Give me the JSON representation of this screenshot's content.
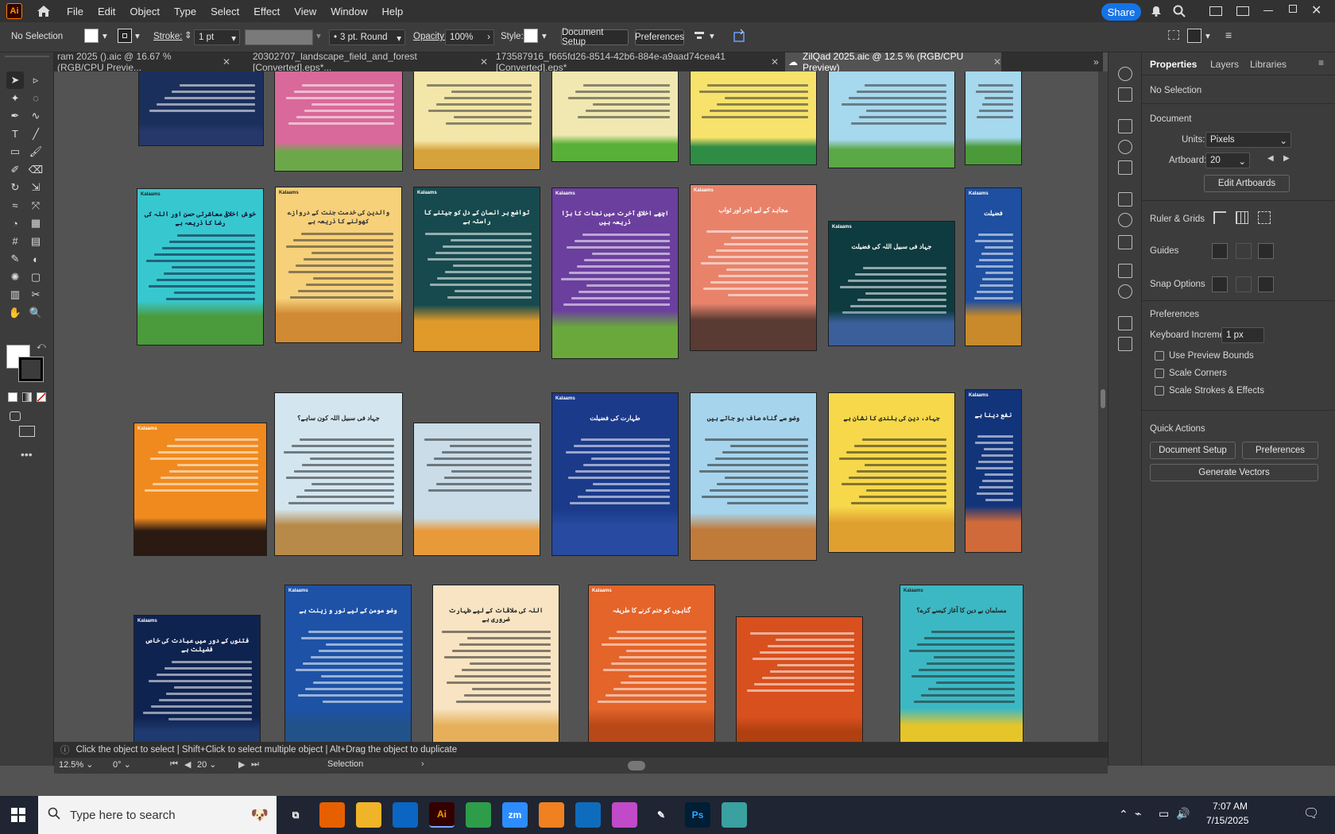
{
  "menubar": {
    "app_logo": "Ai",
    "items": [
      "File",
      "Edit",
      "Object",
      "Type",
      "Select",
      "Effect",
      "View",
      "Window",
      "Help"
    ],
    "share_label": "Share"
  },
  "control": {
    "selection_label": "No Selection",
    "stroke_label": "Stroke:",
    "stroke_value": "1 pt",
    "brush_value": "3 pt. Round",
    "opacity_label": "Opacity:",
    "opacity_value": "100%",
    "style_label": "Style:",
    "document_setup": "Document Setup",
    "preferences": "Preferences"
  },
  "tabs": [
    {
      "label": "ram 2025 ().aic @ 16.67 % (RGB/CPU Previe...",
      "active": false
    },
    {
      "label": "20302707_landscape_field_and_forest [Converted].eps*...",
      "active": false
    },
    {
      "label": "173587916_f665fd26-8514-42b6-884e-a9aad74cea41 [Converted].eps*",
      "active": false
    },
    {
      "label": "ZilQad 2025.aic @ 12.5 % (RGB/CPU Preview)",
      "active": true
    }
  ],
  "artboards": [
    {
      "brand": "",
      "title": "",
      "bg": "#1b2f5c",
      "scene": "#26386a",
      "fg": "#fff"
    },
    {
      "brand": "",
      "title": "",
      "bg": "#d9699a",
      "scene": "#6ca84a",
      "fg": "#fff"
    },
    {
      "brand": "",
      "title": "",
      "bg": "#f3e6a8",
      "scene": "#d6a23b",
      "fg": "#333"
    },
    {
      "brand": "",
      "title": "",
      "bg": "#f0e8b0",
      "scene": "#58b038",
      "fg": "#333"
    },
    {
      "brand": "",
      "title": "",
      "bg": "#f7e36b",
      "scene": "#2f8c44",
      "fg": "#333"
    },
    {
      "brand": "",
      "title": "",
      "bg": "#a6d8ee",
      "scene": "#5aa846",
      "fg": "#333"
    },
    {
      "brand": "",
      "title": "",
      "bg": "#a6d8ee",
      "scene": "#4a9a3a",
      "fg": "#333"
    },
    {
      "brand": "Kalaams",
      "title": "خوش اخلاقی معاشرتی حسن اور اللہ کی رضا کا ذریعہ ہے",
      "bg": "#37c8cf",
      "scene": "#4b9a3b",
      "fg": "#113"
    },
    {
      "brand": "Kalaams",
      "title": "والدین کی خدمت جنت کے دروازے کھولنے کا ذریعہ ہے",
      "bg": "#f7d07a",
      "scene": "#d08a34",
      "fg": "#333"
    },
    {
      "brand": "Kalaams",
      "title": "تواضع ہر انسان کے دل کو جیتنے کا راستہ ہے",
      "bg": "#174a4e",
      "scene": "#e09a2a",
      "fg": "#fff"
    },
    {
      "brand": "Kalaams",
      "title": "اچھے اخلاق آخرت میں نجات کا بڑا ذریعہ ہیں",
      "bg": "#6b3f9e",
      "scene": "#6aa83c",
      "fg": "#fff"
    },
    {
      "brand": "Kalaams",
      "title": "مجاہد کے لیے اجر اور ثواب",
      "bg": "#e8836a",
      "scene": "#5a3b33",
      "fg": "#fff"
    },
    {
      "brand": "Kalaams",
      "title": "جہاد فی سبیل اللہ کی فضیلت",
      "bg": "#0d3b40",
      "scene": "#3a5f9a",
      "fg": "#fff"
    },
    {
      "brand": "Kalaams",
      "title": "فضیلت",
      "bg": "#1e4fa0",
      "scene": "#c88a2a",
      "fg": "#fff"
    },
    {
      "brand": "Kalaams",
      "title": "",
      "bg": "#f08a1e",
      "scene": "#2a1a12",
      "fg": "#fff"
    },
    {
      "brand": "",
      "title": "جہاد فی سبیل اللہ کون ساہے؟",
      "bg": "#d3e6f0",
      "scene": "#b88a4a",
      "fg": "#222"
    },
    {
      "brand": "",
      "title": "",
      "bg": "#c9dce8",
      "scene": "#e89a3a",
      "fg": "#222"
    },
    {
      "brand": "Kalaams",
      "title": "طہارت کی فضیلت",
      "bg": "#1b3a8a",
      "scene": "#284aa0",
      "fg": "#fff"
    },
    {
      "brand": "",
      "title": "وضو سے گناہ صاف ہو جاتے ہیں",
      "bg": "#a6d4ec",
      "scene": "#c07a3a",
      "fg": "#222"
    },
    {
      "brand": "",
      "title": "جہاد، دین کی بلندی کا نشان ہے",
      "bg": "#f6d84a",
      "scene": "#e0a030",
      "fg": "#222"
    },
    {
      "brand": "Kalaams",
      "title": "نفع دینا ہے",
      "bg": "#12347a",
      "scene": "#d06a3a",
      "fg": "#fff"
    },
    {
      "brand": "Kalaams",
      "title": "فتنوں کے دور میں عبادت کی خاص فضیلت ہے",
      "bg": "#0f2350",
      "scene": "#1e3a70",
      "fg": "#fff"
    },
    {
      "brand": "Kalaams",
      "title": "وضو مومن کے لیے نور و زینت ہے",
      "bg": "#1d52a6",
      "scene": "#22528a",
      "fg": "#fff"
    },
    {
      "brand": "",
      "title": "اللہ کی ملاقات کے لیے طہارت ضروری ہے",
      "bg": "#f8e4c2",
      "scene": "#e6b05a",
      "fg": "#222"
    },
    {
      "brand": "Kalaams",
      "title": "گناہوں کو ختم کرنے کا طریقہ",
      "bg": "#e4642a",
      "scene": "#b84818",
      "fg": "#fff"
    },
    {
      "brand": "",
      "title": "",
      "bg": "#d8501e",
      "scene": "#b04010",
      "fg": "#fff"
    },
    {
      "brand": "Kalaams",
      "title": "مسلمان بے دین کا آغاز کیسے کرے؟",
      "bg": "#3cb8c4",
      "scene": "#e6c52a",
      "fg": "#222"
    }
  ],
  "toolbar_icons": [
    "selection-tool-icon",
    "direct-selection-tool-icon",
    "magic-wand-icon",
    "lasso-icon",
    "pen-tool-icon",
    "curvature-icon",
    "type-tool-icon",
    "line-tool-icon",
    "rectangle-tool-icon",
    "paintbrush-icon",
    "shaper-icon",
    "eraser-icon",
    "rotate-icon",
    "scale-icon",
    "warp-icon",
    "free-transform-icon",
    "shape-builder-icon",
    "perspective-icon",
    "mesh-icon",
    "gradient-icon",
    "eyedropper-icon",
    "blend-icon",
    "symbol-sprayer-icon",
    "artboard-tool-icon",
    "column-graph-icon",
    "slice-icon",
    "hand-tool-icon",
    "zoom-tool-icon"
  ],
  "properties": {
    "tabs": [
      "Properties",
      "Layers",
      "Libraries"
    ],
    "no_selection": "No Selection",
    "document": "Document",
    "units_label": "Units:",
    "units_value": "Pixels",
    "artboard_label": "Artboard:",
    "artboard_value": "20",
    "edit_artboards": "Edit Artboards",
    "ruler_grids": "Ruler & Grids",
    "guides": "Guides",
    "snap_options": "Snap Options",
    "preferences": "Preferences",
    "keyboard_increment_label": "Keyboard Increment:",
    "keyboard_increment_value": "1 px",
    "use_preview_bounds": "Use Preview Bounds",
    "scale_corners": "Scale Corners",
    "scale_strokes": "Scale Strokes & Effects",
    "quick_actions": "Quick Actions",
    "document_setup": "Document Setup",
    "preferences_btn": "Preferences",
    "generate_vectors": "Generate Vectors"
  },
  "hint": "Click the object to select  |  Shift+Click to select multiple object  |  Alt+Drag the object to duplicate",
  "status": {
    "zoom": "12.5%",
    "rotation": "0°",
    "artboard_nav": "20",
    "tool_name": "Selection"
  },
  "taskbar": {
    "search_placeholder": "Type here to search",
    "apps": [
      "task-view",
      "firefox",
      "file-explorer",
      "vscode",
      "illustrator",
      "chrome",
      "zoom",
      "app-7",
      "outlook",
      "copilot",
      "tool",
      "photoshop",
      "app-12"
    ],
    "app_labels": {
      "illustrator": "Ai",
      "zoom": "zm",
      "photoshop": "Ps"
    },
    "time": "7:07 AM",
    "date": "7/15/2025"
  }
}
